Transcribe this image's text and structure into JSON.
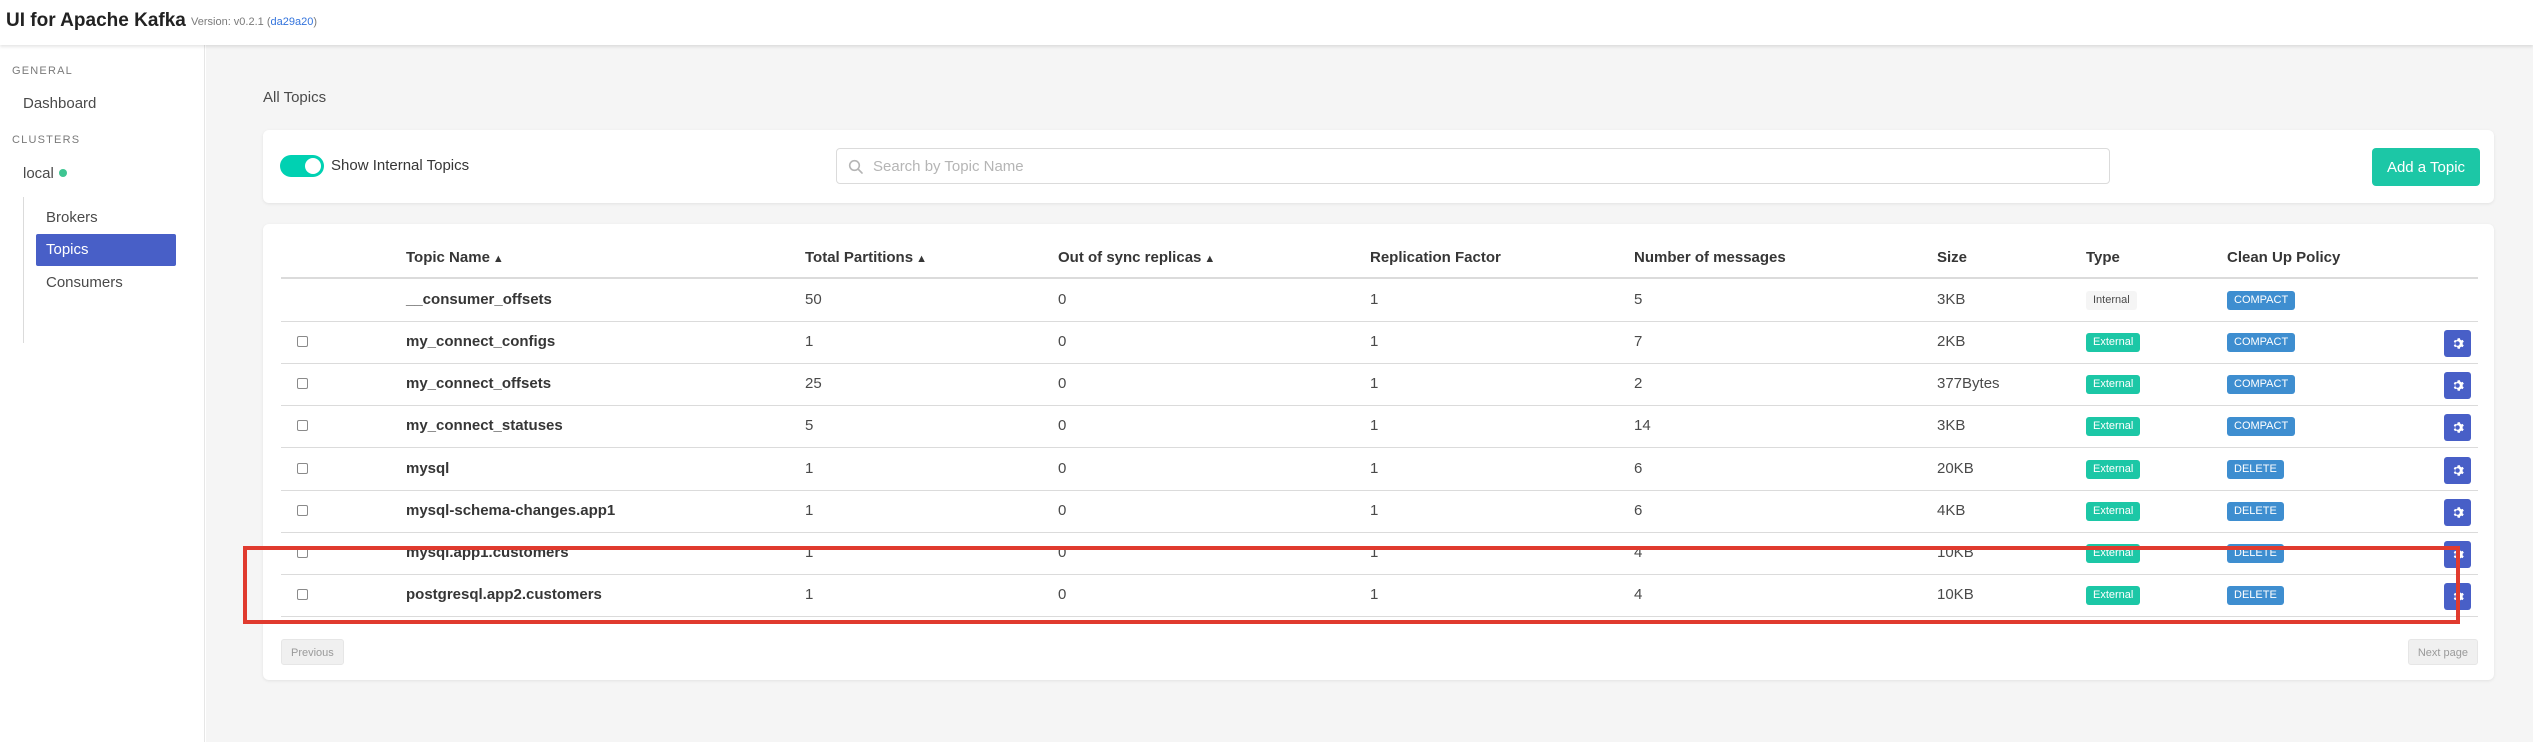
{
  "app": {
    "title": "UI for Apache Kafka",
    "version_prefix": "Version: v0.2.1 (",
    "version_hash": "da29a20",
    "version_suffix": ")"
  },
  "sidebar": {
    "general_label": "GENERAL",
    "dashboard": "Dashboard",
    "clusters_label": "CLUSTERS",
    "cluster_name": "local",
    "cluster_status_color": "#3ec592",
    "items": [
      {
        "label": "Brokers",
        "active": false
      },
      {
        "label": "Topics",
        "active": true
      },
      {
        "label": "Consumers",
        "active": false
      }
    ]
  },
  "main": {
    "title": "All Topics",
    "toolbar": {
      "toggle_label": "Show Internal Topics",
      "toggle_on": true,
      "search_placeholder": "Search by Topic Name",
      "add_button": "Add a Topic"
    },
    "table": {
      "columns": [
        "Topic Name",
        "Total Partitions",
        "Out of sync replicas",
        "Replication Factor",
        "Number of messages",
        "Size",
        "Type",
        "Clean Up Policy"
      ],
      "sortable": [
        true,
        true,
        true,
        false,
        false,
        false,
        false,
        false
      ],
      "rows": [
        {
          "name": "__consumer_offsets",
          "partitions": "50",
          "out_of_sync": "0",
          "replication": "1",
          "messages": "5",
          "size": "3KB",
          "type": "Internal",
          "policy": "COMPACT",
          "checkbox": false,
          "settings": false
        },
        {
          "name": "my_connect_configs",
          "partitions": "1",
          "out_of_sync": "0",
          "replication": "1",
          "messages": "7",
          "size": "2KB",
          "type": "External",
          "policy": "COMPACT",
          "checkbox": true,
          "settings": true
        },
        {
          "name": "my_connect_offsets",
          "partitions": "25",
          "out_of_sync": "0",
          "replication": "1",
          "messages": "2",
          "size": "377Bytes",
          "type": "External",
          "policy": "COMPACT",
          "checkbox": true,
          "settings": true
        },
        {
          "name": "my_connect_statuses",
          "partitions": "5",
          "out_of_sync": "0",
          "replication": "1",
          "messages": "14",
          "size": "3KB",
          "type": "External",
          "policy": "COMPACT",
          "checkbox": true,
          "settings": true
        },
        {
          "name": "mysql",
          "partitions": "1",
          "out_of_sync": "0",
          "replication": "1",
          "messages": "6",
          "size": "20KB",
          "type": "External",
          "policy": "DELETE",
          "checkbox": true,
          "settings": true
        },
        {
          "name": "mysql-schema-changes.app1",
          "partitions": "1",
          "out_of_sync": "0",
          "replication": "1",
          "messages": "6",
          "size": "4KB",
          "type": "External",
          "policy": "DELETE",
          "checkbox": true,
          "settings": true
        },
        {
          "name": "mysql.app1.customers",
          "partitions": "1",
          "out_of_sync": "0",
          "replication": "1",
          "messages": "4",
          "size": "10KB",
          "type": "External",
          "policy": "DELETE",
          "checkbox": true,
          "settings": true
        },
        {
          "name": "postgresql.app2.customers",
          "partitions": "1",
          "out_of_sync": "0",
          "replication": "1",
          "messages": "4",
          "size": "10KB",
          "type": "External",
          "policy": "DELETE",
          "checkbox": true,
          "settings": true
        }
      ]
    },
    "pagination": {
      "previous": "Previous",
      "next": "Next page"
    }
  },
  "colors": {
    "accent": "#485fc7",
    "external_tag": "#1cc7a6",
    "policy_tag": "#3e8ed0",
    "highlight": "#e03a2e"
  }
}
